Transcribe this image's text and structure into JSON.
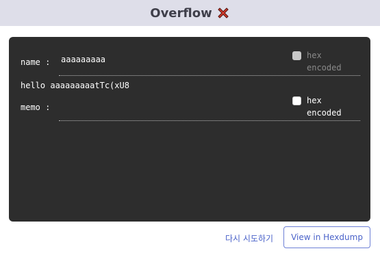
{
  "header": {
    "title": "Overflow",
    "status_icon": "cross-icon",
    "background": "#dedee9"
  },
  "panel": {
    "background": "#2d2d2d",
    "name_label": "name :",
    "name_value": "aaaaaaaaa",
    "name_hex_checkbox": {
      "label_line1": "hex",
      "label_line2": "encoded",
      "checked": false,
      "enabled": false
    },
    "output_line": "hello aaaaaaaaatTc(xU8",
    "memo_label": "memo :",
    "memo_value": "",
    "memo_hex_checkbox": {
      "label_line1": "hex",
      "label_line2": "encoded",
      "checked": false,
      "enabled": true
    }
  },
  "actions": {
    "retry_label": "다시 시도하기",
    "hexdump_label": "View in Hexdump",
    "accent": "#4a62c9"
  }
}
